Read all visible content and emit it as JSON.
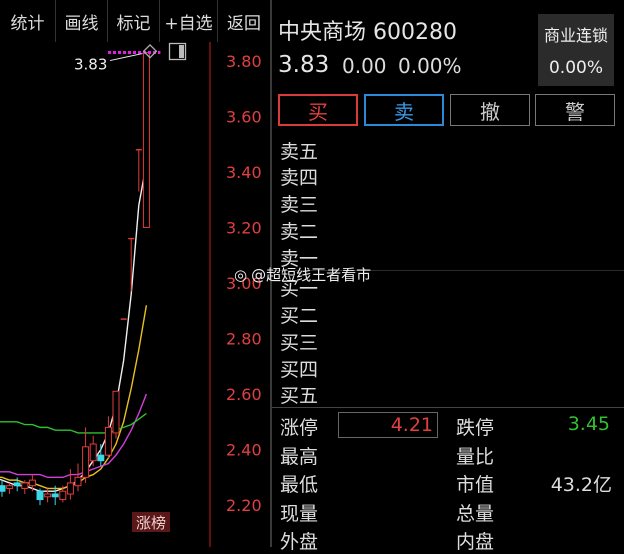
{
  "toolbar": {
    "stats": "统计",
    "draw": "画线",
    "mark": "标记",
    "add_watch": "+自选",
    "back": "返回"
  },
  "chart": {
    "price_callout": "3.83",
    "rank_badge": "涨榜",
    "colors": {
      "up": "#e03c3c",
      "down": "#3ad8e8",
      "ma_white": "#f0f0f0",
      "ma_yellow": "#e8c020",
      "ma_magenta": "#d040d8",
      "ma_green": "#30c030",
      "high_marker": "#e020e0"
    }
  },
  "chart_data": {
    "type": "candlestick",
    "y_ticks": [
      "3.80",
      "3.60",
      "3.40",
      "3.20",
      "3.00",
      "2.80",
      "2.60",
      "2.40",
      "2.20"
    ],
    "ylim": [
      2.15,
      3.85
    ],
    "highest_annotation": "3.83",
    "candles": [
      {
        "o": 2.27,
        "c": 2.25,
        "h": 2.29,
        "l": 2.23
      },
      {
        "o": 2.26,
        "c": 2.27,
        "h": 2.28,
        "l": 2.24
      },
      {
        "o": 2.28,
        "c": 2.27,
        "h": 2.3,
        "l": 2.25
      },
      {
        "o": 2.26,
        "c": 2.28,
        "h": 2.29,
        "l": 2.24
      },
      {
        "o": 2.27,
        "c": 2.29,
        "h": 2.31,
        "l": 2.25
      },
      {
        "o": 2.25,
        "c": 2.22,
        "h": 2.26,
        "l": 2.2
      },
      {
        "o": 2.23,
        "c": 2.24,
        "h": 2.26,
        "l": 2.21
      },
      {
        "o": 2.24,
        "c": 2.23,
        "h": 2.27,
        "l": 2.2
      },
      {
        "o": 2.22,
        "c": 2.25,
        "h": 2.27,
        "l": 2.21
      },
      {
        "o": 2.24,
        "c": 2.28,
        "h": 2.33,
        "l": 2.22
      },
      {
        "o": 2.27,
        "c": 2.3,
        "h": 2.35,
        "l": 2.25
      },
      {
        "o": 2.3,
        "c": 2.41,
        "h": 2.48,
        "l": 2.28
      },
      {
        "o": 2.36,
        "c": 2.42,
        "h": 2.45,
        "l": 2.34
      },
      {
        "o": 2.38,
        "c": 2.36,
        "h": 2.42,
        "l": 2.34
      },
      {
        "o": 2.38,
        "c": 2.48,
        "h": 2.52,
        "l": 2.37
      },
      {
        "o": 2.46,
        "c": 2.61,
        "h": 2.61,
        "l": 2.44
      },
      {
        "o": 2.87,
        "c": 2.87,
        "h": 2.87,
        "l": 2.87
      },
      {
        "o": 3.16,
        "c": 3.16,
        "h": 3.16,
        "l": 2.97
      },
      {
        "o": 3.48,
        "c": 3.48,
        "h": 3.48,
        "l": 3.33
      },
      {
        "o": 3.2,
        "c": 3.83,
        "h": 3.83,
        "l": 3.2
      }
    ],
    "ma": [
      {
        "name": "white",
        "values": [
          2.3,
          2.29,
          2.28,
          2.27,
          2.27,
          2.26,
          2.25,
          2.25,
          2.25,
          2.26,
          2.27,
          2.29,
          2.32,
          2.36,
          2.4,
          2.46,
          2.56,
          2.72,
          2.96,
          3.28,
          3.43
        ]
      },
      {
        "name": "yellow",
        "values": [
          2.3,
          2.3,
          2.29,
          2.29,
          2.28,
          2.28,
          2.27,
          2.26,
          2.26,
          2.26,
          2.27,
          2.28,
          2.3,
          2.31,
          2.33,
          2.37,
          2.42,
          2.5,
          2.62,
          2.76,
          2.92
        ]
      },
      {
        "name": "magenta",
        "values": [
          2.32,
          2.32,
          2.32,
          2.31,
          2.31,
          2.31,
          2.31,
          2.3,
          2.3,
          2.3,
          2.31,
          2.31,
          2.32,
          2.33,
          2.34,
          2.35,
          2.38,
          2.42,
          2.47,
          2.53,
          2.6
        ]
      },
      {
        "name": "green",
        "values": [
          2.5,
          2.5,
          2.5,
          2.5,
          2.49,
          2.49,
          2.48,
          2.48,
          2.47,
          2.47,
          2.47,
          2.46,
          2.46,
          2.46,
          2.46,
          2.46,
          2.47,
          2.48,
          2.49,
          2.51,
          2.53
        ]
      }
    ]
  },
  "quote": {
    "name_code": "中央商场 600280",
    "price": "3.83",
    "change": "0.00",
    "change_pct": "0.00%",
    "sector_name": "商业连锁",
    "sector_pct": "0.00%"
  },
  "actions": {
    "buy": "买",
    "sell": "卖",
    "cancel": "撤",
    "alert": "警"
  },
  "order_book": {
    "asks": [
      "卖五",
      "卖四",
      "卖三",
      "卖二",
      "卖一"
    ],
    "bids": [
      "买一",
      "买二",
      "买三",
      "买四",
      "买五"
    ]
  },
  "stats": {
    "limit_up_label": "涨停",
    "limit_up_value": "4.21",
    "limit_down_label": "跌停",
    "limit_down_value": "3.45",
    "high_label": "最高",
    "volume_ratio_label": "量比",
    "low_label": "最低",
    "market_cap_label": "市值",
    "market_cap_value": "43.2亿",
    "current_vol_label": "现量",
    "total_vol_label": "总量",
    "outer_label": "外盘",
    "inner_label": "内盘",
    "colors": {
      "limit_up": "#e04040",
      "limit_down": "#30c030"
    }
  },
  "watermark": "@超短线王者看市"
}
